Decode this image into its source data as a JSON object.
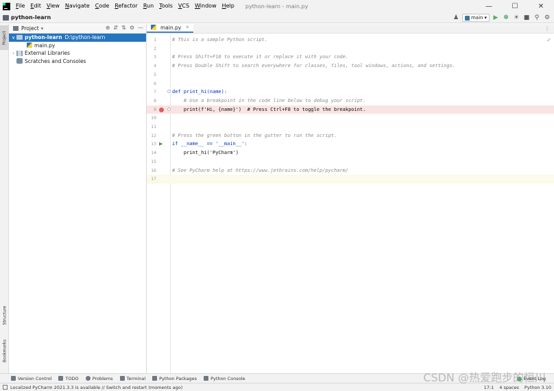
{
  "menubar": {
    "items": [
      "File",
      "Edit",
      "View",
      "Navigate",
      "Code",
      "Refactor",
      "Run",
      "Tools",
      "VCS",
      "Window",
      "Help"
    ],
    "window_title": "python-learn - main.py",
    "minimize": "—",
    "maximize": "☐",
    "close": "✕"
  },
  "navbar": {
    "project_name": "python-learn",
    "run_config": "main",
    "icons": [
      "user-icon",
      "run-config-icon",
      "run-icon",
      "debug-icon",
      "coverage-icon",
      "stop-icon",
      "search-icon",
      "settings-icon"
    ]
  },
  "left_stripe": {
    "project_tab": "Project",
    "structure_tab": "Structure",
    "bookmarks_tab": "Bookmarks"
  },
  "project_panel": {
    "title": "Project",
    "tree": [
      {
        "label": "python-learn",
        "path": "D:\\python-learn",
        "type": "folder",
        "expanded": true,
        "selected": true
      },
      {
        "label": "main.py",
        "type": "file"
      },
      {
        "label": "External Libraries",
        "type": "library",
        "expanded": false
      },
      {
        "label": "Scratches and Consoles",
        "type": "scratch"
      }
    ]
  },
  "editor": {
    "tab_label": "main.py",
    "lines": [
      {
        "n": "1",
        "text": "# This is a sample Python script."
      },
      {
        "n": "2",
        "text": ""
      },
      {
        "n": "3",
        "text": "# Press Shift+F10 to execute it or replace it with your code."
      },
      {
        "n": "4",
        "text": "# Press Double Shift to search everywhere for classes, files, tool windows, actions, and settings."
      },
      {
        "n": "5",
        "text": ""
      },
      {
        "n": "6",
        "text": ""
      },
      {
        "n": "7",
        "text": "def print_hi(name):"
      },
      {
        "n": "8",
        "text": "    # Use a breakpoint in the code line below to debug your script."
      },
      {
        "n": "9",
        "text": "    print(f'Hi, {name}')  # Press Ctrl+F8 to toggle the breakpoint."
      },
      {
        "n": "10",
        "text": ""
      },
      {
        "n": "11",
        "text": ""
      },
      {
        "n": "12",
        "text": "# Press the green button in the gutter to run the script."
      },
      {
        "n": "13",
        "text": "if __name__ == '__main__':"
      },
      {
        "n": "14",
        "text": "    print_hi('PyCharm')"
      },
      {
        "n": "15",
        "text": ""
      },
      {
        "n": "16",
        "text": "# See PyCharm help at https://www.jetbrains.com/help/pycharm/"
      },
      {
        "n": "17",
        "text": ""
      }
    ]
  },
  "bottom_bar": {
    "tabs": [
      "Version Control",
      "TODO",
      "Problems",
      "Terminal",
      "Python Packages",
      "Python Console"
    ],
    "event_log": "Event Log"
  },
  "status_bar": {
    "message": "Localized PyCharm 2021.3.3 is available // Switch and restart (moments ago)",
    "position": "17:1",
    "indent": "4 spaces",
    "interpreter": "Python 3.10"
  },
  "watermark": "CSDN @热爱跑步的恒川"
}
